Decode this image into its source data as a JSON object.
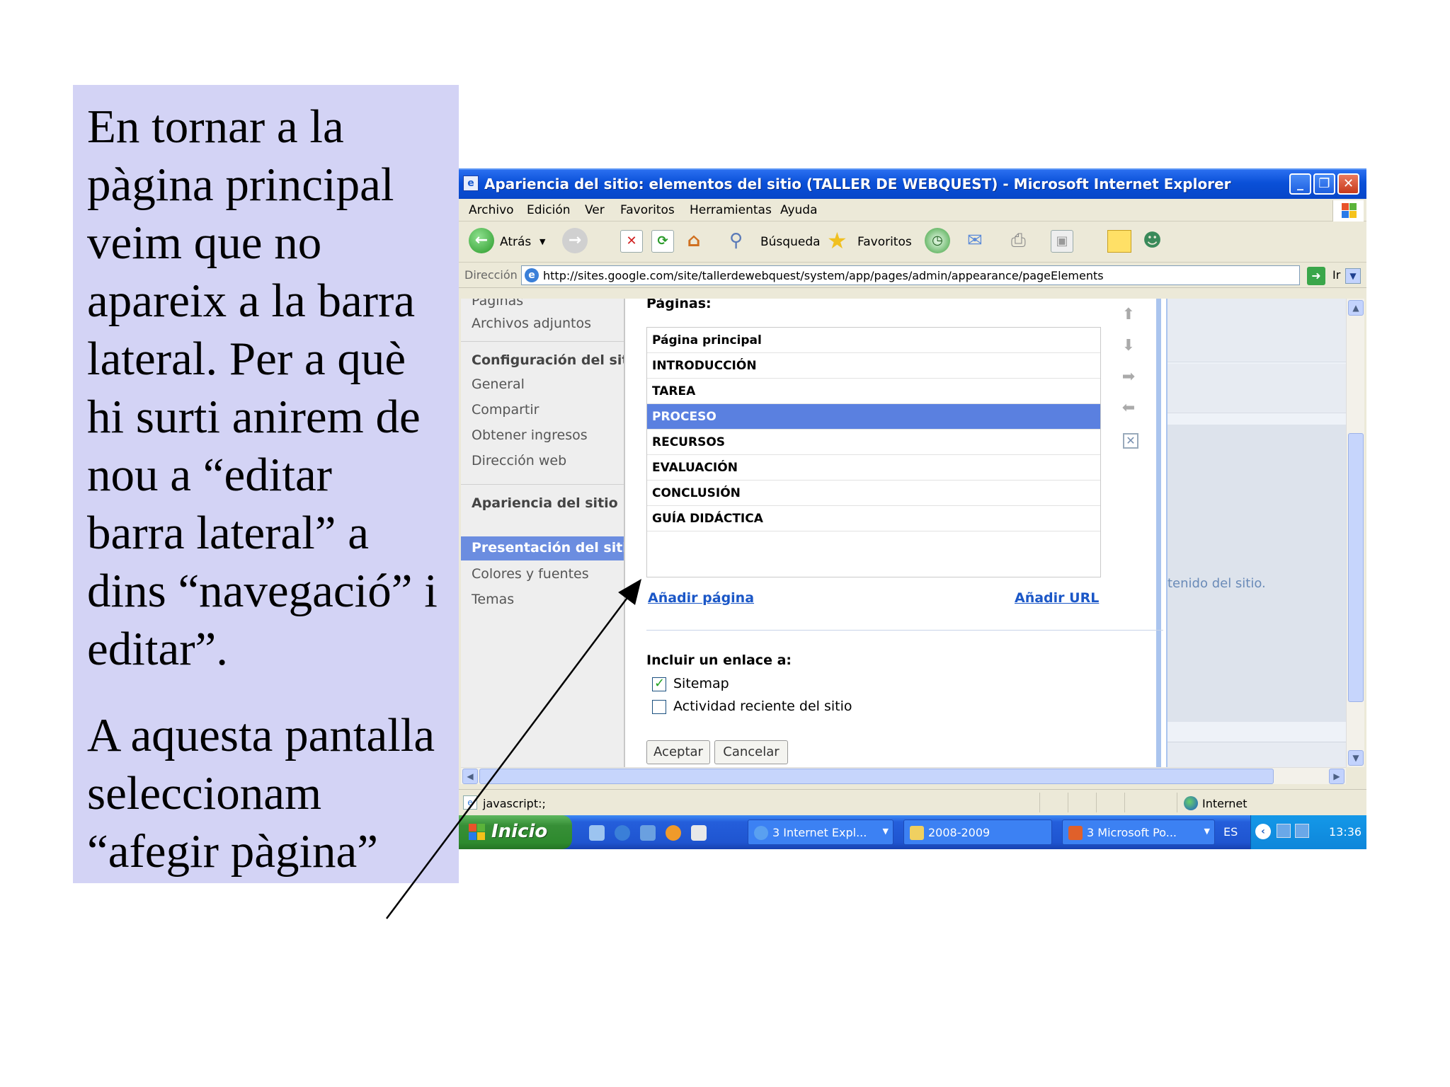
{
  "slide": {
    "paragraph1": "En tornar  a la\npàgina principal\nveim que no\napareix a la barra\nlateral. Per a què\nhi surti anirem de\nnou a “editar\nbarra lateral” a\ndins “navegació” i\neditar”.",
    "paragraph2": "A aquesta pantalla\nseleccionam\n“afegir pàgina”",
    "panel_color": "#d3d3f5"
  },
  "window": {
    "title": "Apariencia del sitio: elementos del sitio (TALLER DE WEBQUEST) - Microsoft Internet Explorer",
    "title_bar_color": "#0a50d8"
  },
  "menu": [
    "Archivo",
    "Edición",
    "Ver",
    "Favoritos",
    "Herramientas",
    "Ayuda"
  ],
  "toolbar": {
    "back_label": "Atrás",
    "search_label": "Búsqueda",
    "favorites_label": "Favoritos"
  },
  "address": {
    "label": "Dirección",
    "url": "http://sites.google.com/site/tallerdewebquest/system/app/pages/admin/appearance/pageElements",
    "go_label": "Ir"
  },
  "sidebar": {
    "items_top": [
      "Páginas",
      "Archivos adjuntos"
    ],
    "config_heading": "Configuración del siti",
    "config_items": [
      "General",
      "Compartir",
      "Obtener ingresos",
      "Dirección web"
    ],
    "appearance_heading": "Apariencia del sitio",
    "selected_item": "Presentación del sitio",
    "appearance_items": [
      "Colores y fuentes",
      "Temas"
    ]
  },
  "dialog": {
    "pages_label": "Páginas:",
    "pages": [
      "Página principal",
      "INTRODUCCIÓN",
      "TAREA",
      "PROCESO",
      "RECURSOS",
      "EVALUACIÓN",
      "CONCLUSIÓN",
      "GUÍA DIDÁCTICA"
    ],
    "selected_page": "PROCESO",
    "add_page_link": "Añadir página",
    "add_url_link": "Añadir URL",
    "include_label": "Incluir un enlace a:",
    "checkbox_sitemap": "Sitemap",
    "checkbox_activity": "Actividad reciente del sitio",
    "sitemap_checked": true,
    "activity_checked": false,
    "accept_button": "Aceptar",
    "cancel_button": "Cancelar",
    "selection_color": "#5a80e0"
  },
  "right_panel": {
    "text": "tenido del sitio."
  },
  "status": {
    "text": "javascript:;",
    "zone": "Internet"
  },
  "taskbar": {
    "start_label": "Inicio",
    "tasks": [
      "3 Internet Expl...",
      "2008-2009",
      "3 Microsoft Po..."
    ],
    "language": "ES",
    "clock": "13:36"
  }
}
